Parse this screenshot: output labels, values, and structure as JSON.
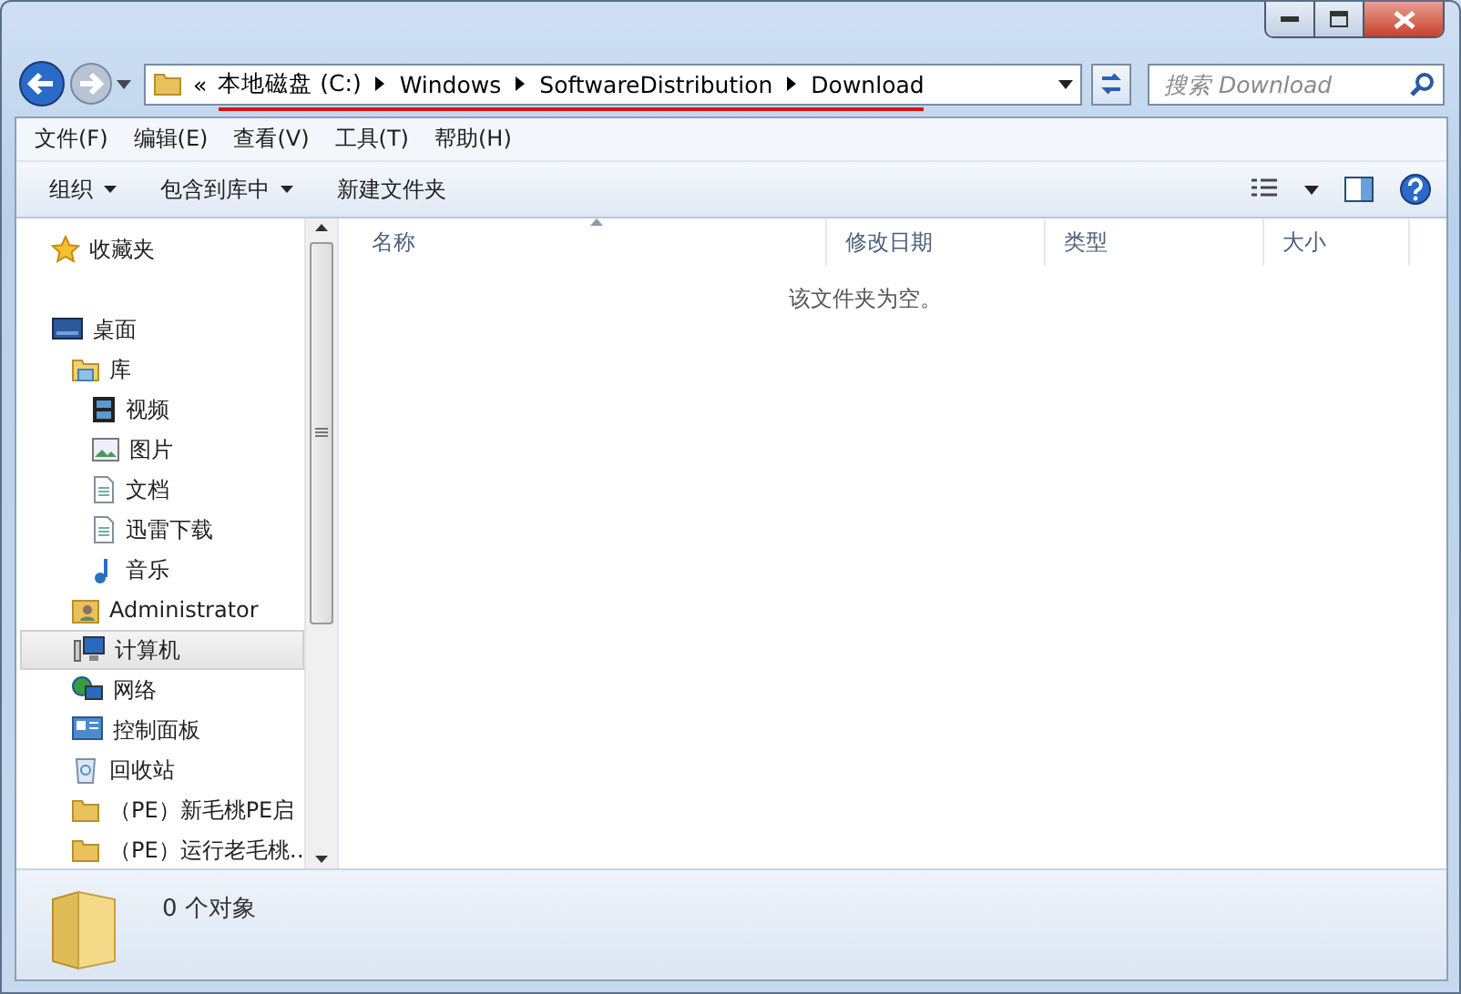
{
  "address": {
    "overflow": "«",
    "path": [
      "本地磁盘 (C:)",
      "Windows",
      "SoftwareDistribution",
      "Download"
    ]
  },
  "search": {
    "placeholder": "搜索 Download"
  },
  "menu": [
    "文件(F)",
    "编辑(E)",
    "查看(V)",
    "工具(T)",
    "帮助(H)"
  ],
  "toolbar": [
    {
      "label": "组织",
      "dropdown": true
    },
    {
      "label": "包含到库中",
      "dropdown": true
    },
    {
      "label": "新建文件夹",
      "dropdown": false
    }
  ],
  "sidebar": {
    "items": [
      {
        "label": "收藏夹",
        "kind": "favorites",
        "selected": false
      },
      {
        "label": "桌面",
        "kind": "desktop",
        "selected": false,
        "children": [
          {
            "label": "库",
            "kind": "library",
            "selected": false,
            "children": [
              {
                "label": "视频",
                "kind": "video",
                "selected": false
              },
              {
                "label": "图片",
                "kind": "pictures",
                "selected": false
              },
              {
                "label": "文档",
                "kind": "document",
                "selected": false
              },
              {
                "label": "迅雷下载",
                "kind": "document",
                "selected": false
              },
              {
                "label": "音乐",
                "kind": "music",
                "selected": false
              }
            ]
          },
          {
            "label": "Administrator",
            "kind": "user",
            "selected": false
          },
          {
            "label": "计算机",
            "kind": "computer",
            "selected": true
          },
          {
            "label": "网络",
            "kind": "network",
            "selected": false
          },
          {
            "label": "控制面板",
            "kind": "control",
            "selected": false
          },
          {
            "label": "回收站",
            "kind": "recycle",
            "selected": false
          },
          {
            "label": "（PE）新毛桃PE启",
            "kind": "folder",
            "selected": false
          },
          {
            "label": "（PE）运行老毛桃…",
            "kind": "folder",
            "selected": false
          }
        ]
      }
    ]
  },
  "table": {
    "columns": [
      {
        "label": "名称",
        "sorted": true
      },
      {
        "label": "修改日期",
        "sorted": false
      },
      {
        "label": "类型",
        "sorted": false
      },
      {
        "label": "大小",
        "sorted": false
      }
    ],
    "empty_message": "该文件夹为空。"
  },
  "status_bar": {
    "count": "0 个对象"
  }
}
